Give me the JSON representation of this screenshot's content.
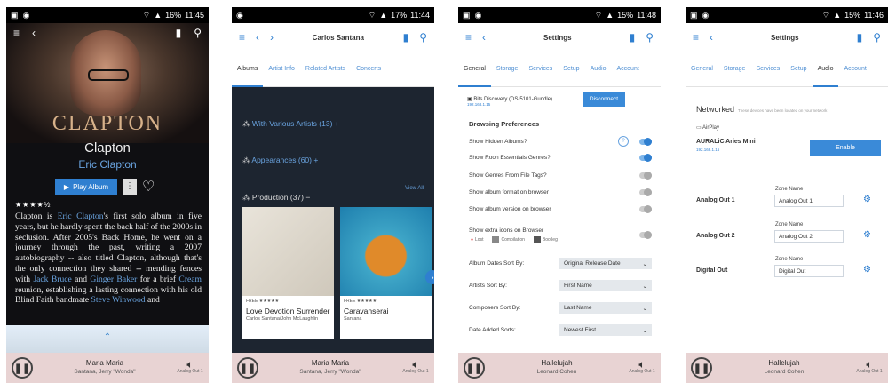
{
  "p1": {
    "status": {
      "time": "11:45",
      "battery": "16%"
    },
    "cover_text": "CLAPTON",
    "album_title": "Clapton",
    "artist": "Eric Clapton",
    "play_label": "Play Album",
    "rating": "★★★★½",
    "bio": {
      "t1": "Clapton is ",
      "l1": "Eric Clapton",
      "t2": "'s first solo album in five years, but he hardly spent the back half of the 2000s in seclusion. After 2005's Back Home, he went on a journey through the past, writing a 2007 autobiography -- also titled Clapton, although that's the only connection they shared -- mending fences with ",
      "l2": "Jack Bruce",
      "t3": " and ",
      "l3": "Ginger Baker",
      "t4": " for a brief ",
      "l4": "Cream",
      "t5": " reunion, establishing a lasting connection with his old Blind Faith bandmate ",
      "l5": "Steve Winwood",
      "t6": " and"
    },
    "player": {
      "title": "Maria Maria",
      "artist": "Santana, Jerry \"Wonda\"",
      "zone": "Analog Out 1"
    }
  },
  "p2": {
    "status": {
      "time": "11:44",
      "battery": "17%"
    },
    "title": "Carlos Santana",
    "tabs": [
      "Albums",
      "Artist Info",
      "Related Artists",
      "Concerts"
    ],
    "sections": {
      "various": {
        "label": "With Various Artists (13)"
      },
      "appear": {
        "label": "Appearances (60)"
      },
      "production": {
        "label": "Production (37)"
      }
    },
    "view_all": "View All",
    "cards": [
      {
        "meta": "FREE ★★★★★",
        "name": "Love Devotion Surrender",
        "artist": "Carlos Santana/John McLaughlin"
      },
      {
        "meta": "FREE ★★★★★",
        "name": "Caravanserai",
        "artist": "Santana"
      }
    ],
    "player": {
      "title": "Maria Maria",
      "artist": "Santana, Jerry \"Wonda\"",
      "zone": "Analog Out 1"
    }
  },
  "p3": {
    "status": {
      "time": "11:48",
      "battery": "15%"
    },
    "title": "Settings",
    "tabs": [
      "General",
      "Storage",
      "Services",
      "Setup",
      "Audio",
      "Account"
    ],
    "device": {
      "name": "Bits Discovery (DS-5101-Gundle)",
      "ip": "192.168.1.15"
    },
    "disconnect": "Disconnect",
    "browsing": "Browsing Preferences",
    "toggles": [
      "Show Hidden Albums?",
      "Show Roon Essentials Genres?",
      "Show Genres From File Tags?",
      "Show album format on browser",
      "Show album version on browser",
      "Show extra icons on Browser"
    ],
    "chips": [
      "Lost",
      "Compilation",
      "Bootleg"
    ],
    "selects": [
      {
        "label": "Album Dates Sort By:",
        "value": "Original Release Date"
      },
      {
        "label": "Artists Sort By:",
        "value": "First Name"
      },
      {
        "label": "Composers Sort By:",
        "value": "Last Name"
      },
      {
        "label": "Date Added Sorts:",
        "value": "Newest First"
      }
    ],
    "player": {
      "title": "Hallelujah",
      "artist": "Leonard Cohen",
      "zone": "Analog Out 1"
    }
  },
  "p4": {
    "status": {
      "time": "11:46",
      "battery": "15%"
    },
    "title": "Settings",
    "tabs": [
      "General",
      "Storage",
      "Services",
      "Setup",
      "Audio",
      "Account"
    ],
    "networked": "Networked",
    "networked_note": "These devices have been located on your network",
    "airplay": "AirPlay",
    "device": {
      "name": "AURALiC Aries Mini",
      "ip": "192.168.1.16"
    },
    "enable": "Enable",
    "zone_label": "Zone Name",
    "outputs": [
      {
        "name": "Analog Out 1",
        "zone": "Analog Out 1"
      },
      {
        "name": "Analog Out 2",
        "zone": "Analog Out 2"
      },
      {
        "name": "Digital Out",
        "zone": "Digital Out"
      }
    ],
    "player": {
      "title": "Hallelujah",
      "artist": "Leonard Cohen",
      "zone": "Analog Out 1"
    }
  },
  "colors": {
    "accent": "#2f7fd0",
    "player_bg": "#e8d3d3",
    "dark_bg": "#1d2530"
  }
}
